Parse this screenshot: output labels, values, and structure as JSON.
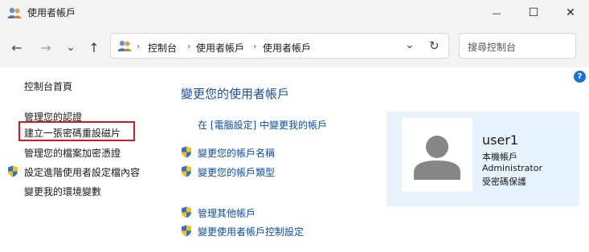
{
  "window": {
    "title": "使用者帳戶",
    "minimize": "—",
    "maximize": "☐",
    "close": "✕"
  },
  "nav": {
    "back": "←",
    "forward": "→",
    "recent": "⌄",
    "up": "↑",
    "refresh": "↻",
    "dropdown": "⌄"
  },
  "breadcrumb": {
    "items": [
      "控制台",
      "使用者帳戶",
      "使用者帳戶"
    ],
    "separator": "›"
  },
  "search": {
    "placeholder": "搜尋控制台"
  },
  "help": "?",
  "sidebar": {
    "home": "控制台首頁",
    "items": [
      "管理您的認證",
      "建立一張密碼重設磁片",
      "管理您的檔案加密憑證",
      "設定進階使用者設定檔內容",
      "變更我的環境變數"
    ]
  },
  "main": {
    "heading": "變更您的使用者帳戶",
    "settings_link": "在 [電腦設定] 中變更我的帳戶",
    "actions": [
      "變更您的帳戶名稱",
      "變更您的帳戶類型"
    ],
    "other_actions": [
      "管理其他帳戶",
      "變更使用者帳戶控制設定"
    ]
  },
  "user": {
    "name": "user1",
    "type": "本機帳戶",
    "role": "Administrator",
    "protection": "受密碼保護"
  },
  "colors": {
    "accent": "#1b4ea0",
    "highlight": "#d9191f",
    "card_bg": "#e6f2fc"
  }
}
